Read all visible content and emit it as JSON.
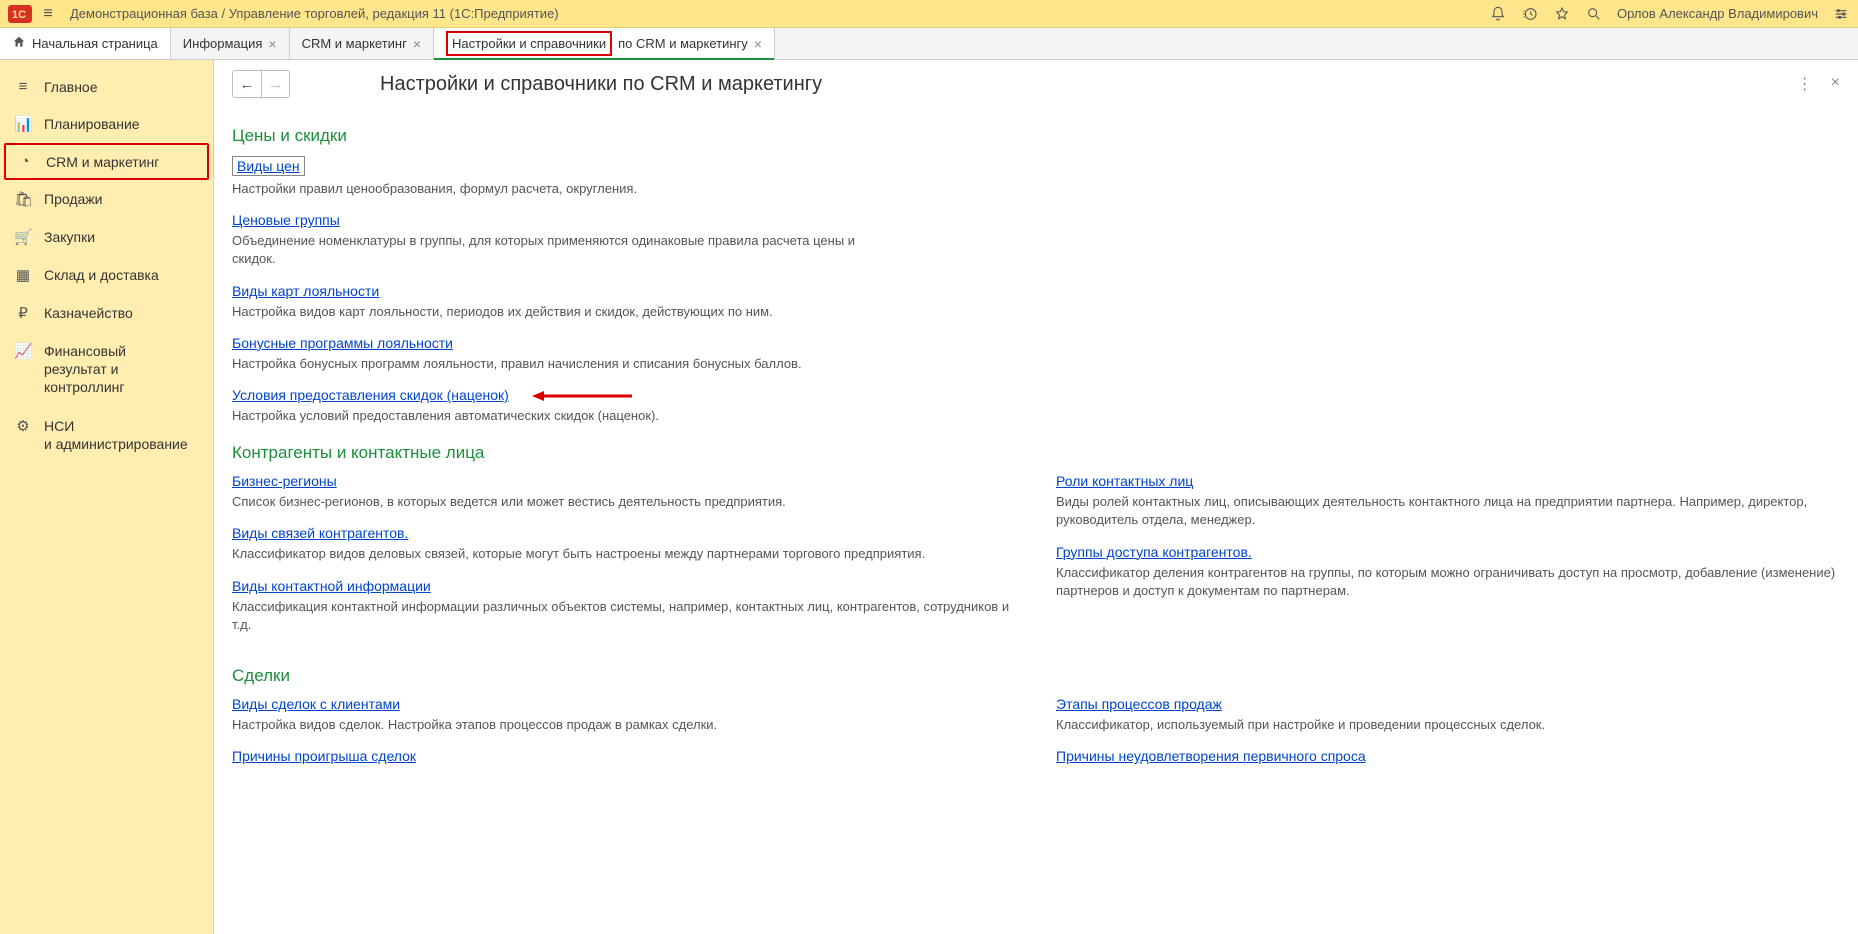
{
  "titlebar": {
    "title": "Демонстрационная база / Управление торговлей, редакция 11   (1С:Предприятие)",
    "user": "Орлов Александр Владимирович"
  },
  "tabs": {
    "home": "Начальная страница",
    "t1": "Информация",
    "t2": "CRM и маркетинг",
    "t3_hl": "Настройки и справочники",
    "t3_rest": " по CRM и маркетингу"
  },
  "sidebar": {
    "items": [
      {
        "label": "Главное",
        "icon": "≡"
      },
      {
        "label": "Планирование",
        "icon": "📊"
      },
      {
        "label": "CRM и маркетинг",
        "icon": "◔",
        "hl": true
      },
      {
        "label": "Продажи",
        "icon": "🛍"
      },
      {
        "label": "Закупки",
        "icon": "🛒"
      },
      {
        "label": "Склад и доставка",
        "icon": "▦"
      },
      {
        "label": "Казначейство",
        "icon": "₽"
      },
      {
        "label": "Финансовый\nрезультат и контроллинг",
        "icon": "📈"
      },
      {
        "label": "НСИ\nи администрирование",
        "icon": "⚙"
      }
    ]
  },
  "page": {
    "title": "Настройки и справочники по CRM и маркетингу",
    "sections": {
      "prices": {
        "heading": "Цены и скидки",
        "items": [
          {
            "link": "Виды цен",
            "boxed": true,
            "desc": "Настройки правил ценообразования, формул расчета, округления."
          },
          {
            "link": "Ценовые группы",
            "desc": "Объединение номенклатуры в группы, для которых применяются одинаковые правила расчета цены и скидок."
          },
          {
            "link": "Виды карт лояльности",
            "desc": "Настройка видов карт лояльности, периодов их действия и скидок, действующих по ним."
          },
          {
            "link": "Бонусные программы лояльности",
            "desc": "Настройка бонусных программ лояльности, правил начисления и списания бонусных баллов."
          },
          {
            "link": "Условия предоставления скидок (наценок)",
            "arrow": true,
            "desc": "Настройка условий предоставления автоматических скидок (наценок)."
          }
        ]
      },
      "contr": {
        "heading": "Контрагенты и контактные лица",
        "left": [
          {
            "link": "Бизнес-регионы",
            "desc": "Список бизнес-регионов, в которых ведется или может вестись деятельность предприятия."
          },
          {
            "link": "Виды связей контрагентов.",
            "desc": "Классификатор видов деловых связей, которые могут быть настроены между партнерами торгового предприятия."
          },
          {
            "link": "Виды контактной информации",
            "desc": "Классификация контактной информации различных объектов системы, например, контактных лиц, контрагентов, сотрудников и т.д."
          }
        ],
        "right": [
          {
            "link": "Роли контактных лиц",
            "desc": "Виды ролей контактных лиц, описывающих деятельность контактного лица на предприятии партнера. Например, директор, руководитель отдела, менеджер."
          },
          {
            "link": "Группы доступа контрагентов.",
            "desc": "Классификатор деления контрагентов на группы, по которым можно ограничивать доступ на просмотр, добавление (изменение) партнеров и доступ к документам по партнерам."
          }
        ]
      },
      "deals": {
        "heading": "Сделки",
        "left": [
          {
            "link": "Виды сделок с клиентами",
            "desc": "Настройка видов сделок. Настройка этапов процессов продаж в рамках сделки."
          },
          {
            "link": "Причины проигрыша сделок",
            "desc": ""
          }
        ],
        "right": [
          {
            "link": "Этапы процессов продаж",
            "desc": "Классификатор, используемый при настройке и проведении процессных сделок."
          },
          {
            "link": "Причины неудовлетворения первичного спроса",
            "desc": ""
          }
        ]
      }
    }
  }
}
